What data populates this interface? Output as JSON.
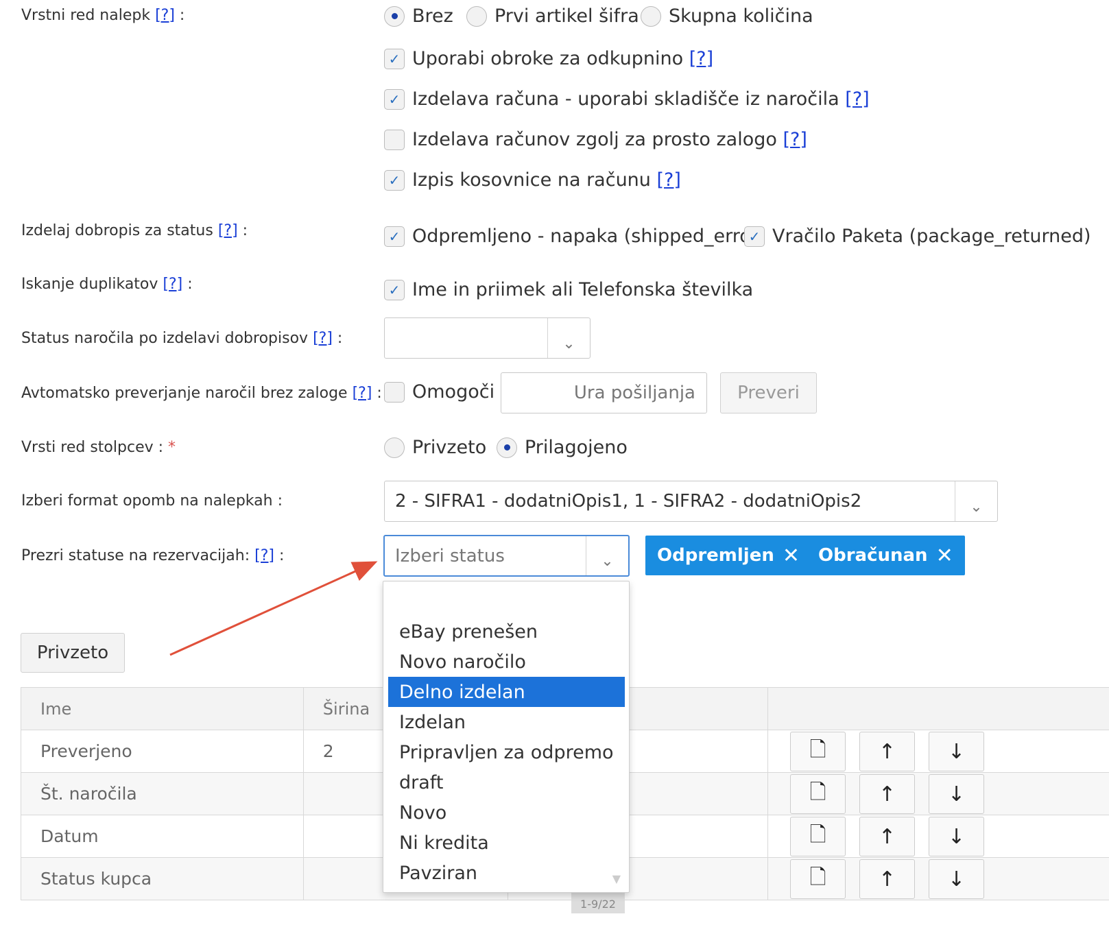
{
  "help_mark": "[?]",
  "colon": ":",
  "rows": {
    "label_order": {
      "label": "Vrstni red nalepk",
      "options": [
        "Brez",
        "Prvi artikel šifra",
        "Skupna količina"
      ],
      "selected": "Brez"
    },
    "checks": [
      {
        "label": "Uporabi obroke za odkupnino",
        "checked": true,
        "help": "[?]"
      },
      {
        "label": "Izdelava računa - uporabi skladišče iz naročila",
        "checked": true,
        "help": "[?]"
      },
      {
        "label": "Izdelava računov zgolj za prosto zalogo",
        "checked": false,
        "help": "[?]"
      },
      {
        "label": "Izpis kosovnice na računu",
        "checked": true,
        "help": "[?]"
      }
    ],
    "credit_note": {
      "label": "Izdelaj dobropis za status",
      "options": [
        "Odpremljeno - napaka (shipped_error)",
        "Vračilo Paketa (package_returned)"
      ]
    },
    "duplicates": {
      "label": "Iskanje duplikatov",
      "option": "Ime in priimek ali Telefonska številka"
    },
    "status_after": {
      "label": "Status naročila po izdelavi dobropisov",
      "value": ""
    },
    "auto_check": {
      "label": "Avtomatsko preverjanje naročil brez zaloge",
      "enable": "Omogoči",
      "time_placeholder": "Ura pošiljanja",
      "button": "Preveri"
    },
    "column_order": {
      "label": "Vrsti red stolpcev :",
      "required": "*",
      "options": [
        "Privzeto",
        "Prilagojeno"
      ],
      "selected": "Prilagojeno"
    },
    "note_format": {
      "label": "Izberi format opomb na nalepkah :",
      "value": "2 - SIFRA1 - dodatniOpis1, 1 - SIFRA2 - dodatniOpis2"
    },
    "ignore_status": {
      "label": "Prezri statuse na rezervacijah:",
      "placeholder": "Izberi status",
      "tags": [
        "Odpremljen",
        "Obračunan"
      ]
    }
  },
  "dropdown": {
    "items": [
      "eBay prenešen",
      "Novo naročilo",
      "Delno izdelan",
      "Izdelan",
      "Pripravljen za odpremo",
      "draft",
      "Novo",
      "Ni kredita",
      "Pavziran"
    ],
    "active": "Delno izdelan"
  },
  "default_button": "Privzeto",
  "table": {
    "headers": [
      "Ime",
      "Širina",
      "",
      ""
    ],
    "rows": [
      {
        "name": "Preverjeno",
        "width": "2"
      },
      {
        "name": "Št. naročila",
        "width": ""
      },
      {
        "name": "Datum",
        "width": ""
      },
      {
        "name": "Status kupca",
        "width": ""
      }
    ]
  },
  "pager_text": "1-9/22",
  "icons": {
    "radio": "radio-icon",
    "check": "checkmark-icon",
    "chevron": "chevron-down-icon",
    "remove": "close-icon",
    "delete_row": "file-delete-icon",
    "up": "arrow-up-icon",
    "down": "arrow-down-icon"
  },
  "colors": {
    "accent": "#1a8de0",
    "active_item": "#1c72d9",
    "help_link": "#1a3fd6",
    "required": "#d9534f",
    "annotation_arrow": "#e0503a"
  }
}
